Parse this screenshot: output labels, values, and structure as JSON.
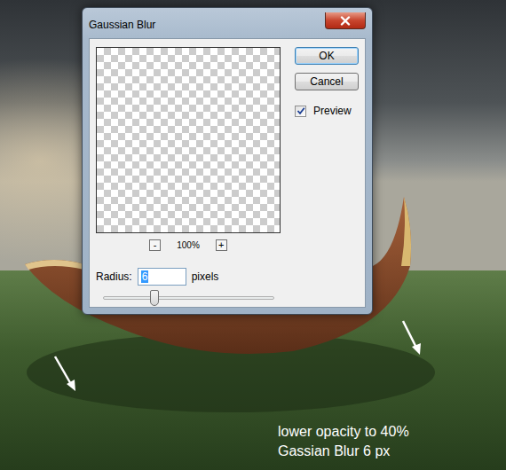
{
  "window": {
    "title": "Gaussian Blur"
  },
  "buttons": [
    {
      "label": "OK",
      "default": true
    },
    {
      "label": "Cancel",
      "default": false
    }
  ],
  "preview": {
    "label": "Preview",
    "checked": true
  },
  "zoom": {
    "out": "-",
    "level": "100%",
    "in": "+"
  },
  "radius": {
    "label": "Radius:",
    "value": "6",
    "unit": "pixels",
    "level": 0.3
  },
  "caption": [
    "lower opacity to 40%",
    "Gassian Blur 6 px"
  ]
}
